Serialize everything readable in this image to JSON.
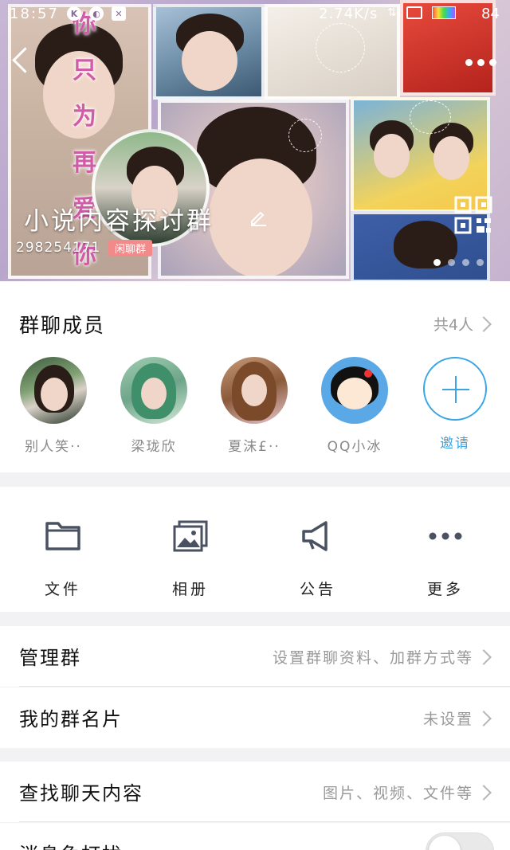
{
  "status_bar": {
    "time": "18:57",
    "network_speed": "2.74K/s",
    "battery": "84"
  },
  "header": {
    "group_name": "小说内容探讨群",
    "group_id": "298254171",
    "group_tag": "闲聊群",
    "banner_text": [
      "你",
      "只",
      "为",
      "再",
      "爱",
      "你"
    ],
    "page_count": 4,
    "active_page": 0
  },
  "members": {
    "title": "群聊成员",
    "count_label": "共4人",
    "list": [
      {
        "name": "别人笑··",
        "avatar": "photo-girl"
      },
      {
        "name": "梁珑欣",
        "avatar": "anime-green-hair"
      },
      {
        "name": "夏沫£··",
        "avatar": "anime-brown-hair"
      },
      {
        "name": "QQ小冰",
        "avatar": "cartoon-girl"
      }
    ],
    "invite_label": "邀请"
  },
  "actions": [
    {
      "label": "文件",
      "icon": "folder-icon"
    },
    {
      "label": "相册",
      "icon": "album-icon"
    },
    {
      "label": "公告",
      "icon": "megaphone-icon"
    },
    {
      "label": "更多",
      "icon": "more-icon"
    }
  ],
  "settings": {
    "manage_group": {
      "title": "管理群",
      "hint": "设置群聊资料、加群方式等"
    },
    "my_card": {
      "title": "我的群名片",
      "hint": "未设置"
    },
    "search_chat": {
      "title": "查找聊天内容",
      "hint": "图片、视频、文件等"
    },
    "dnd": {
      "title": "消息免打扰",
      "enabled": false
    }
  },
  "colors": {
    "accent": "#3aa6e6",
    "tag": "#f28a8a",
    "icon_gray": "#4a5262"
  }
}
